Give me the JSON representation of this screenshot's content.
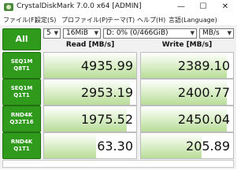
{
  "window": {
    "title": "CrystalDiskMark 7.0.0 x64 [ADMIN]",
    "minimize_glyph": "—",
    "maximize_glyph": "☐",
    "close_glyph": "✕"
  },
  "menu": [
    "ファイル(F)",
    "設定(S)",
    "プロファイル(P)",
    "テーマ(T)",
    "ヘルプ(H)",
    "言語(Language)"
  ],
  "controls": {
    "all_label": "All",
    "count": "5",
    "size": "16MiB",
    "drive": "D: 0% (0/466GiB)",
    "unit": "MB/s"
  },
  "headers": {
    "read": "Read [MB/s]",
    "write": "Write [MB/s]"
  },
  "tests": [
    {
      "line1": "SEQ1M",
      "line2": "Q8T1",
      "read": "4935.99",
      "write": "2389.10",
      "read_fill": 1.0,
      "write_fill": 0.93
    },
    {
      "line1": "SEQ1M",
      "line2": "Q1T1",
      "read": "2953.19",
      "write": "2400.77",
      "read_fill": 0.93,
      "write_fill": 0.93
    },
    {
      "line1": "RND4K",
      "line2": "Q32T16",
      "read": "1975.52",
      "write": "2450.04",
      "read_fill": 0.9,
      "write_fill": 0.93
    },
    {
      "line1": "RND4K",
      "line2": "Q1T1",
      "read": "63.30",
      "write": "205.89",
      "read_fill": 0.56,
      "write_fill": 0.66
    }
  ],
  "icons": {
    "app": "crystaldiskmark-app-icon",
    "dropdown": "chevron-down-icon"
  },
  "colors": {
    "accent_green": "#2f9a1c",
    "bar_green": "#b8dd98"
  },
  "status": ""
}
